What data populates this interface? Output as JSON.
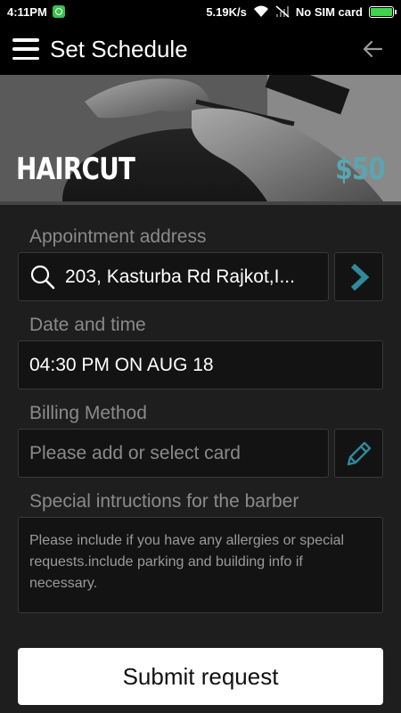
{
  "status_bar": {
    "time": "4:11PM",
    "network_speed": "5.19K/s",
    "carrier": "No SIM card",
    "battery_level": 1.0,
    "icons": [
      "app-notification-icon",
      "wifi-icon",
      "signal-icon",
      "battery-icon"
    ]
  },
  "app_bar": {
    "title": "Set Schedule",
    "menu_icon": "hamburger-menu-icon",
    "back_icon": "back-arrow-icon"
  },
  "service": {
    "name": "HAIRCUT",
    "price": "$50",
    "price_color": "#5aa6b0"
  },
  "form": {
    "address_label": "Appointment address",
    "address_value": "203, Kasturba Rd Rajkot,I...",
    "address_icon": "search-icon",
    "address_button_icon": "chevron-right-icon",
    "datetime_label": "Date and time",
    "datetime_value": "04:30 PM ON AUG 18",
    "billing_label": "Billing Method",
    "billing_placeholder": "Please add or select card",
    "billing_button_icon": "pencil-icon",
    "instructions_label": "Special intructions for the barber",
    "instructions_placeholder": "Please include if you have any allergies or special requests.include parking and building info if necessary."
  },
  "submit_label": "Submit request",
  "colors": {
    "background": "#1e1e1e",
    "field_background": "#131313",
    "accent": "#2f8a9a"
  }
}
